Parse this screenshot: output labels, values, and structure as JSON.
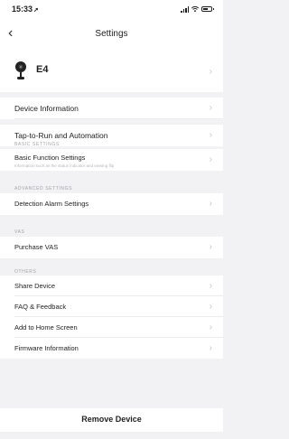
{
  "status_bar": {
    "time": "15:33"
  },
  "nav": {
    "title": "Settings"
  },
  "device": {
    "name": "E4"
  },
  "items": {
    "device_information": "Device Information",
    "tap_to_run": "Tap-to-Run and Automation",
    "basic_function_settings": "Basic Function Settings",
    "basic_function_settings_sub": "Information such as the status indicator and viewing flip",
    "detection_alarm_settings": "Detection Alarm Settings",
    "purchase_vas": "Purchase VAS",
    "share_device": "Share Device",
    "faq_feedback": "FAQ & Feedback",
    "add_to_home_screen": "Add to Home Screen",
    "firmware_information": "Firmware Information"
  },
  "sections": {
    "basic": "BASIC SETTINGS",
    "advanced": "ADVANCED SETTINGS",
    "vas": "VAS",
    "others": "OTHERS"
  },
  "actions": {
    "remove_device": "Remove Device"
  },
  "colors": {
    "background": "#f2f2f4",
    "card": "#ffffff",
    "section_text": "#a3a3a8",
    "chevron": "#c4c4c8"
  }
}
